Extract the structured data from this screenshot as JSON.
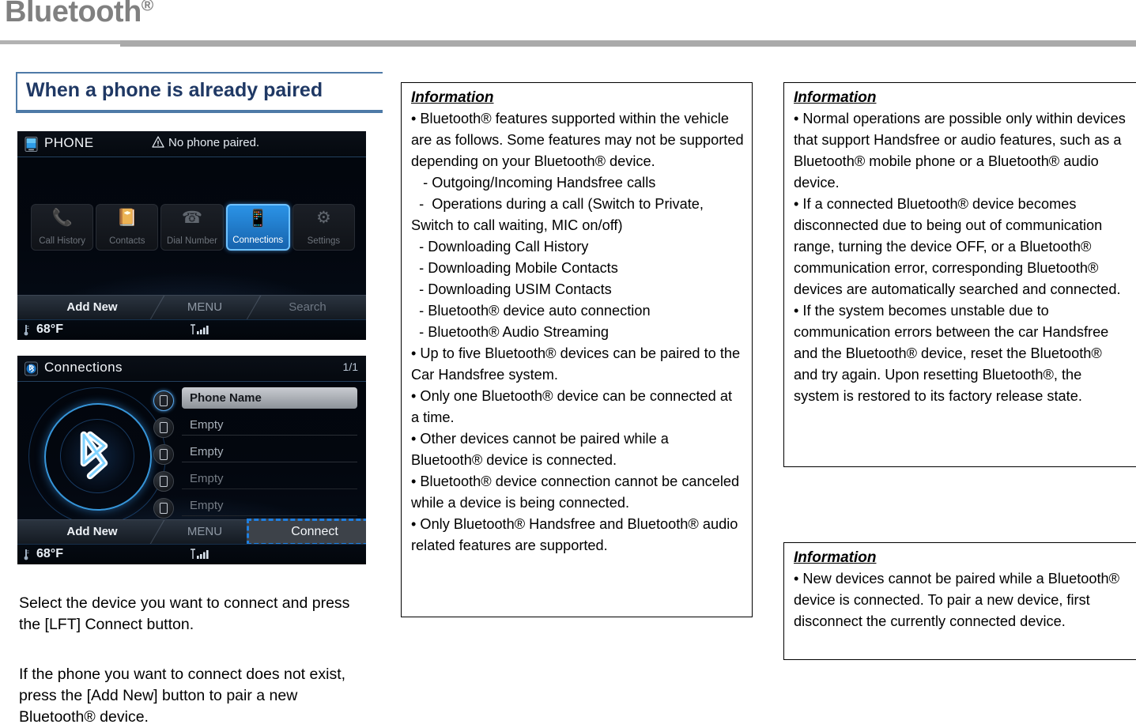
{
  "header": {
    "title": "Bluetooth",
    "registered_mark": "®"
  },
  "section": {
    "heading": "When a phone is already paired"
  },
  "screens": [
    {
      "id": "phone-screen",
      "title": "PHONE",
      "title_icon": "phone-icon",
      "warning_icon": "warning-triangle-icon",
      "warning_text": "No phone paired.",
      "tiles": [
        {
          "label": "Call History",
          "icon": "call-history-icon",
          "selected": false
        },
        {
          "label": "Contacts",
          "icon": "contacts-book-icon",
          "selected": false
        },
        {
          "label": "Dial Number",
          "icon": "dial-handset-icon",
          "selected": false
        },
        {
          "label": "Connections",
          "icon": "connections-phone-icon",
          "selected": true
        },
        {
          "label": "Settings",
          "icon": "gear-icon",
          "selected": false
        }
      ],
      "softkeys": {
        "left": "Add New",
        "center": "MENU",
        "right": "Search"
      },
      "status": {
        "temperature": "68°F",
        "thermometer_icon": "thermometer-icon",
        "signal_icon": "signal-bars-icon"
      }
    },
    {
      "id": "connections-screen",
      "title": "Connections",
      "title_icon": "bluetooth-connections-icon",
      "page_indicator": "1/1",
      "bluetooth_logo_icon": "bluetooth-logo-icon",
      "devices": [
        {
          "name": "Phone Name",
          "state": "selected"
        },
        {
          "name": "Empty",
          "state": "empty"
        },
        {
          "name": "Empty",
          "state": "empty"
        },
        {
          "name": "Empty",
          "state": "empty"
        },
        {
          "name": "Empty",
          "state": "empty"
        }
      ],
      "softkeys": {
        "left": "Add New",
        "center": "MENU",
        "right": "Connect"
      },
      "connect_button": {
        "label": "Connect",
        "highlight_color": "#1f7fe0"
      },
      "status": {
        "temperature": "68°F",
        "thermometer_icon": "thermometer-icon",
        "signal_icon": "signal-bars-icon"
      }
    }
  ],
  "paragraphs": {
    "p1": "Select the device you want to connect and press the [LFT] Connect button.",
    "p2": "If the phone you want to connect does not exist, press the [Add New] button to pair a new Bluetooth® device."
  },
  "info_boxes": {
    "features": {
      "title": "Information",
      "lines": [
        "• Bluetooth® features supported within the vehicle are as follows. Some features may not be supported depending on your Bluetooth® device.",
        "   - Outgoing/Incoming Handsfree calls",
        "  -  Operations during a call (Switch to Private, Switch to call waiting, MIC on/off)",
        "  - Downloading Call History",
        "  - Downloading Mobile Contacts",
        "  - Downloading USIM Contacts",
        "  - Bluetooth® device auto connection",
        "  - Bluetooth® Audio Streaming",
        "• Up to five Bluetooth® devices can be paired to the Car Handsfree system.",
        "• Only one Bluetooth® device can be connected at a time.",
        "• Other devices cannot be paired while a Bluetooth® device is connected.",
        "• Bluetooth® device connection cannot be canceled while a device is being connected.",
        "• Only Bluetooth® Handsfree and Bluetooth® audio related features are supported."
      ]
    },
    "operations": {
      "title": "Information",
      "lines": [
        "• Normal operations are possible only within devices that support Handsfree or audio features, such as a Bluetooth® mobile phone or a Bluetooth® audio device.",
        "• If a connected Bluetooth® device becomes disconnected due to being out of communication range, turning the device OFF, or a Bluetooth® communication error, corresponding Bluetooth® devices are automatically searched and connected.",
        "• If the system becomes unstable due to communication errors between the car Handsfree and the Bluetooth® device, reset the Bluetooth® and try again. Upon resetting Bluetooth®, the system is restored to its factory release state."
      ]
    },
    "pairing": {
      "title": "Information",
      "lines": [
        "• New devices cannot be paired while a Bluetooth® device is connected. To pair a new device, first disconnect the currently connected device."
      ]
    }
  },
  "colors": {
    "header_text": "#808080",
    "header_rule": "#aaaaaa",
    "section_heading": "#1f3864",
    "section_rule": "#4e7aa7",
    "hmi_accent": "#2b93e6",
    "connect_highlight": "#1f7fe0"
  }
}
